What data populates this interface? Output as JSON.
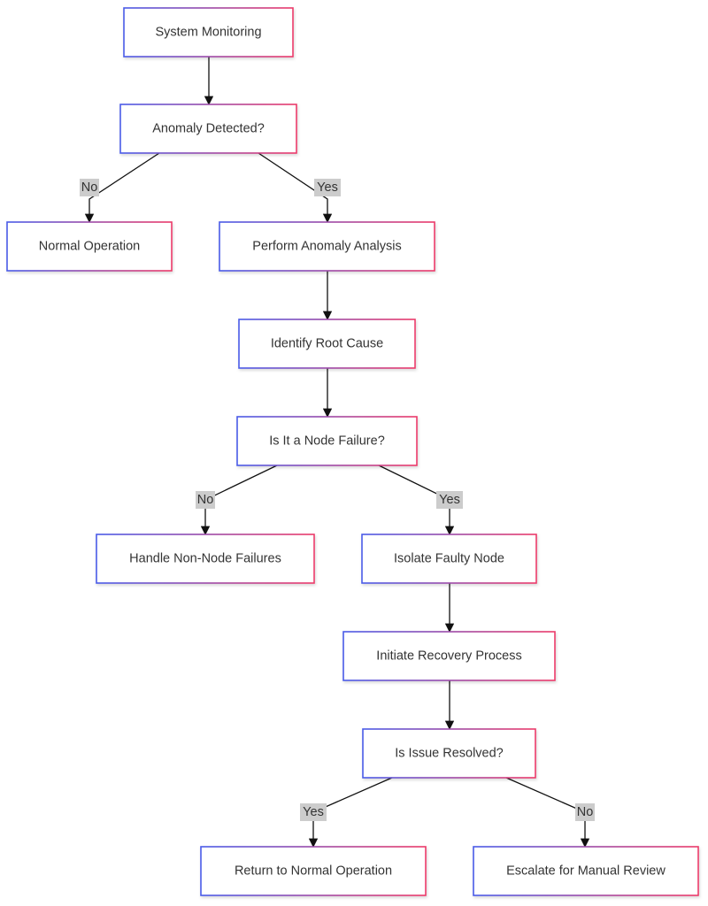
{
  "colors": {
    "border_start": "#4a5be8",
    "border_end": "#ec3a6a",
    "edge": "#111111",
    "label_bg": "#cccccc",
    "text": "#333333"
  },
  "nodes": [
    {
      "id": "system-monitoring",
      "label": "System Monitoring"
    },
    {
      "id": "anomaly-detected",
      "label": "Anomaly Detected?"
    },
    {
      "id": "normal-operation",
      "label": "Normal Operation"
    },
    {
      "id": "perform-anomaly-analysis",
      "label": "Perform Anomaly Analysis"
    },
    {
      "id": "identify-root-cause",
      "label": "Identify Root Cause"
    },
    {
      "id": "is-node-failure",
      "label": "Is It a Node Failure?"
    },
    {
      "id": "handle-non-node-failures",
      "label": "Handle Non-Node Failures"
    },
    {
      "id": "isolate-faulty-node",
      "label": "Isolate Faulty Node"
    },
    {
      "id": "initiate-recovery-process",
      "label": "Initiate Recovery Process"
    },
    {
      "id": "is-issue-resolved",
      "label": "Is Issue Resolved?"
    },
    {
      "id": "return-to-normal-operation",
      "label": "Return to Normal Operation"
    },
    {
      "id": "escalate-manual-review",
      "label": "Escalate for Manual Review"
    }
  ],
  "edges": [
    {
      "from": "system-monitoring",
      "to": "anomaly-detected",
      "label": ""
    },
    {
      "from": "anomaly-detected",
      "to": "normal-operation",
      "label": "No"
    },
    {
      "from": "anomaly-detected",
      "to": "perform-anomaly-analysis",
      "label": "Yes"
    },
    {
      "from": "perform-anomaly-analysis",
      "to": "identify-root-cause",
      "label": ""
    },
    {
      "from": "identify-root-cause",
      "to": "is-node-failure",
      "label": ""
    },
    {
      "from": "is-node-failure",
      "to": "handle-non-node-failures",
      "label": "No"
    },
    {
      "from": "is-node-failure",
      "to": "isolate-faulty-node",
      "label": "Yes"
    },
    {
      "from": "isolate-faulty-node",
      "to": "initiate-recovery-process",
      "label": ""
    },
    {
      "from": "initiate-recovery-process",
      "to": "is-issue-resolved",
      "label": ""
    },
    {
      "from": "is-issue-resolved",
      "to": "return-to-normal-operation",
      "label": "Yes"
    },
    {
      "from": "is-issue-resolved",
      "to": "escalate-manual-review",
      "label": "No"
    }
  ]
}
